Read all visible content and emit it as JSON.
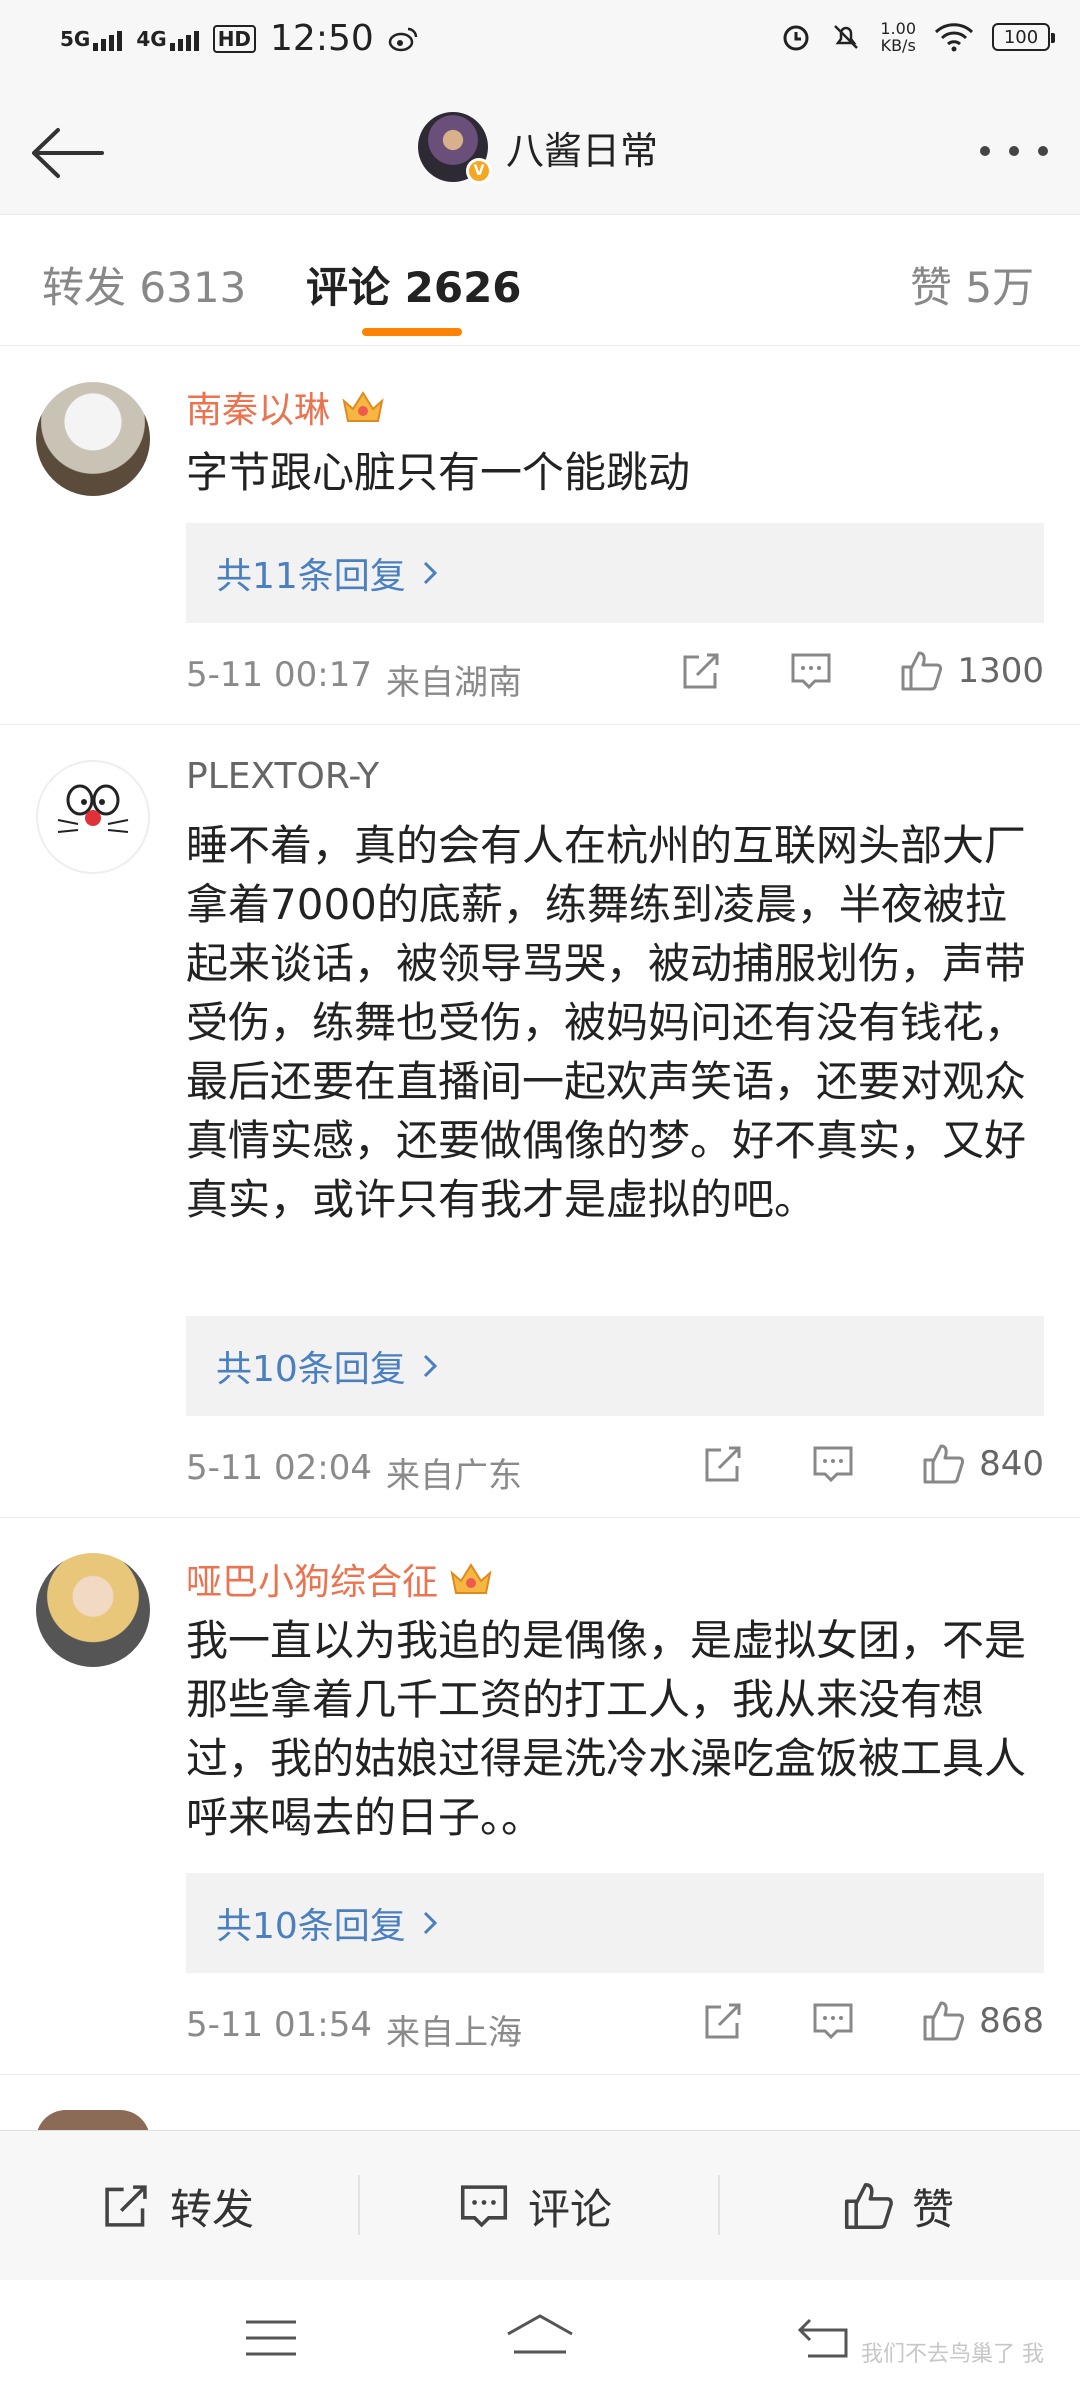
{
  "status_bar": {
    "net1": "5G",
    "net2": "4G",
    "hd": "HD",
    "time": "12:50",
    "speed_value": "1.00",
    "speed_unit": "KB/s",
    "battery": "100"
  },
  "header": {
    "title": "八酱日常",
    "verified_badge": "V"
  },
  "tabs": {
    "repost": {
      "label": "转发",
      "count": "6313"
    },
    "comment": {
      "label": "评论",
      "count": "2626"
    },
    "like": {
      "label": "赞",
      "count": "5万"
    }
  },
  "comments": [
    {
      "name": "南秦以琳",
      "text": "字节跟心脏只有一个能跳动",
      "replies": "共11条回复",
      "time": "5-11 00:17",
      "location": "来自湖南",
      "likes": "1300"
    },
    {
      "name": "PLEXTOR-Y",
      "text": "睡不着，真的会有人在杭州的互联网头部大厂拿着7000的底薪，练舞练到凌晨，半夜被拉起来谈话，被领导骂哭，被动捕服划伤，声带受伤，练舞也受伤，被妈妈问还有没有钱花，最后还要在直播间一起欢声笑语，还要对观众真情实感，还要做偶像的梦。好不真实，又好真实，或许只有我才是虚拟的吧。",
      "replies": "共10条回复",
      "time": "5-11 02:04",
      "location": "来自广东",
      "likes": "840"
    },
    {
      "name": "哑巴小狗综合征",
      "text": "我一直以为我追的是偶像，是虚拟女团，不是那些拿着几千工资的打工人，我从来没有想过，我的姑娘过得是洗冷水澡吃盒饭被工具人呼来喝去的日子。。",
      "replies": "共10条回复",
      "time": "5-11 01:54",
      "location": "来自上海",
      "likes": "868"
    }
  ],
  "bottom_bar": {
    "repost": "转发",
    "comment": "评论",
    "like": "赞"
  },
  "watermark": "我们不去鸟巢了 我",
  "colors": {
    "accent": "#ff8200",
    "vip_name": "#eb7350",
    "link": "#4a7fc0"
  }
}
